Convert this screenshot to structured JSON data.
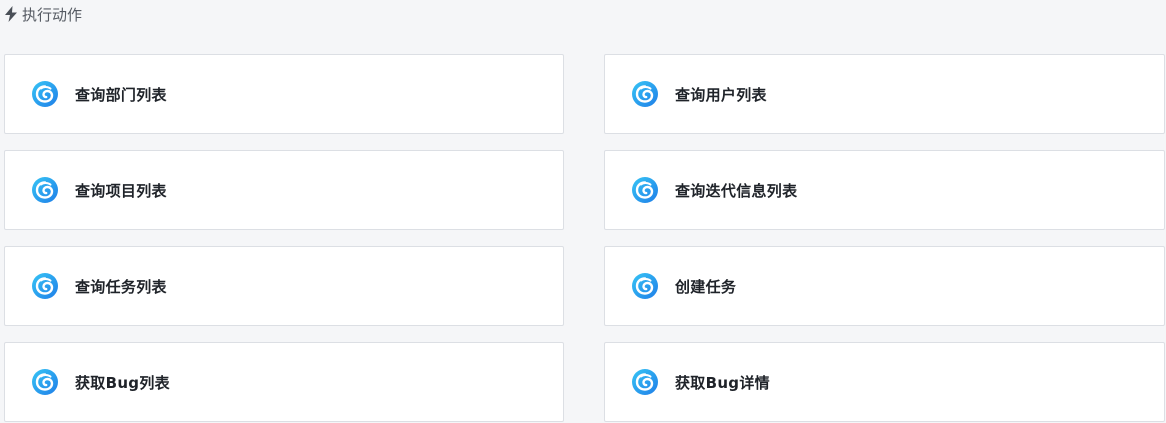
{
  "section": {
    "icon": "lightning-icon",
    "title": "执行动作"
  },
  "actions": [
    {
      "label": "查询部门列表",
      "icon": "app-logo-icon"
    },
    {
      "label": "查询用户列表",
      "icon": "app-logo-icon"
    },
    {
      "label": "查询项目列表",
      "icon": "app-logo-icon"
    },
    {
      "label": "查询迭代信息列表",
      "icon": "app-logo-icon"
    },
    {
      "label": "查询任务列表",
      "icon": "app-logo-icon"
    },
    {
      "label": "创建任务",
      "icon": "app-logo-icon"
    },
    {
      "label": "获取Bug列表",
      "icon": "app-logo-icon"
    },
    {
      "label": "获取Bug详情",
      "icon": "app-logo-icon"
    }
  ],
  "colors": {
    "icon_gradient_start": "#37c5f5",
    "icon_gradient_end": "#1f7ee8",
    "card_border": "#dcdfe4",
    "background": "#f5f6f8"
  }
}
